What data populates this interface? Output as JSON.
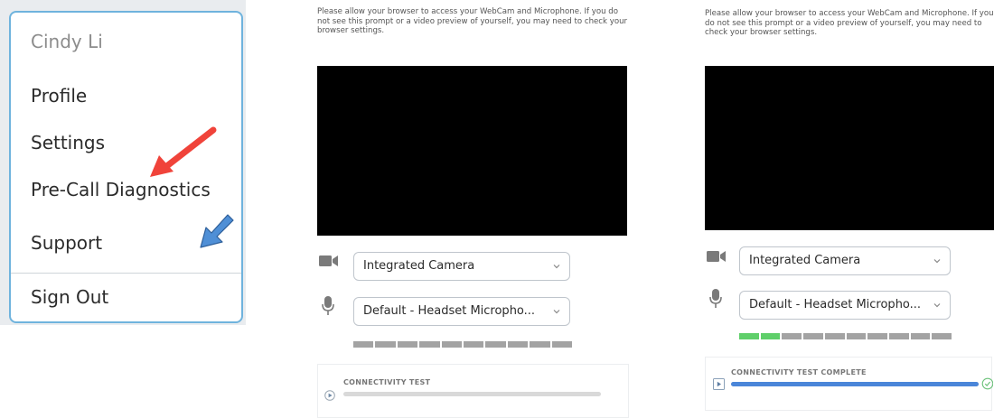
{
  "menu": {
    "user_name": "Cindy Li",
    "items": [
      {
        "label": "Profile"
      },
      {
        "label": "Settings"
      },
      {
        "label": "Pre-Call Diagnostics"
      },
      {
        "label": "Support"
      },
      {
        "label": "Sign Out"
      }
    ]
  },
  "annotations": {
    "primary_arrow_color": "#f0433a",
    "secondary_arrow_color": "#4f8fd6"
  },
  "diagnostics_before": {
    "permission_text": "Please allow your browser to access your WebCam and Microphone. If you do not see this prompt or a video preview of yourself, you may need to check your browser settings.",
    "camera_select": {
      "value": "Integrated Camera",
      "icon": "video-camera-icon"
    },
    "mic_select": {
      "value": "Default - Headset Micropho...",
      "icon": "microphone-icon"
    },
    "mic_level": {
      "active_segments": 0,
      "total_segments": 10
    },
    "connectivity": {
      "title": "CONNECTIVITY TEST",
      "progress": 0
    }
  },
  "diagnostics_after": {
    "permission_text": "Please allow your browser to access your WebCam and Microphone. If you do not see this prompt or a video preview of yourself, you may need to check your browser settings.",
    "camera_select": {
      "value": "Integrated Camera",
      "icon": "video-camera-icon"
    },
    "mic_select": {
      "value": "Default - Headset Micropho...",
      "icon": "microphone-icon"
    },
    "mic_level": {
      "active_segments": 2,
      "total_segments": 10,
      "active_color": "#5fcf6a"
    },
    "connectivity": {
      "title": "CONNECTIVITY TEST COMPLETE",
      "progress": 1.0,
      "status_icon": "check-circle-icon"
    }
  },
  "colors": {
    "menu_border": "#6fb3dd",
    "progress_fill": "#4a86d9",
    "meter_idle": "#a3a3a3",
    "check_green": "#6cc27a"
  }
}
